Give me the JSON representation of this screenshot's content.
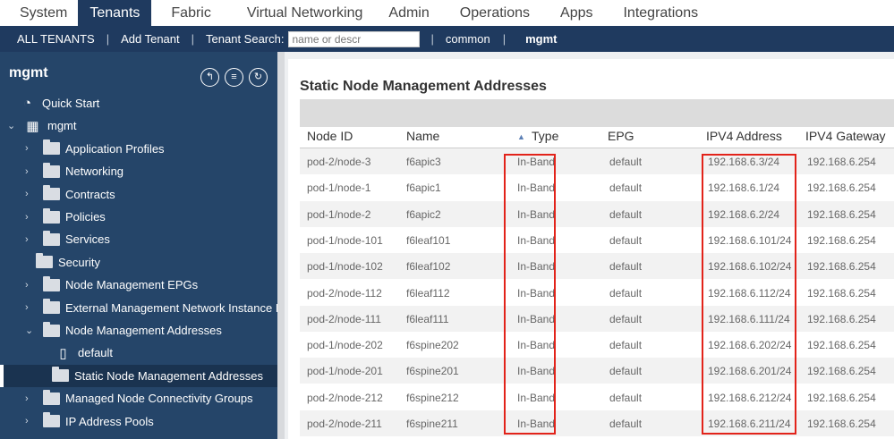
{
  "topnav": {
    "tabs": [
      "System",
      "Tenants",
      "Fabric",
      "Virtual Networking",
      "Admin",
      "Operations",
      "Apps",
      "Integrations"
    ],
    "active": "Tenants"
  },
  "tenant_bar": {
    "all_tenants": "ALL TENANTS",
    "add_tenant": "Add Tenant",
    "search_label": "Tenant Search:",
    "search_placeholder": "name or descr",
    "common": "common",
    "mgmt": "mgmt"
  },
  "sidebar": {
    "title": "mgmt",
    "items": [
      {
        "label": "Quick Start",
        "icon": "quick-start-icon"
      },
      {
        "label": "mgmt",
        "icon": "tenant-icon"
      },
      {
        "label": "Application Profiles",
        "icon": "folder-icon"
      },
      {
        "label": "Networking",
        "icon": "folder-icon"
      },
      {
        "label": "Contracts",
        "icon": "folder-icon"
      },
      {
        "label": "Policies",
        "icon": "folder-icon"
      },
      {
        "label": "Services",
        "icon": "folder-icon"
      },
      {
        "label": "Security",
        "icon": "folder-icon"
      },
      {
        "label": "Node Management EPGs",
        "icon": "folder-icon"
      },
      {
        "label": "External Management Network Instance Pr...",
        "icon": "folder-icon"
      },
      {
        "label": "Node Management Addresses",
        "icon": "folder-icon"
      },
      {
        "label": "default",
        "icon": "document-icon"
      },
      {
        "label": "Static Node Management Addresses",
        "icon": "folder-icon"
      },
      {
        "label": "Managed Node Connectivity Groups",
        "icon": "folder-icon"
      },
      {
        "label": "IP Address Pools",
        "icon": "folder-icon"
      }
    ]
  },
  "main": {
    "title": "Static Node Management Addresses",
    "columns": [
      "Node ID",
      "Name",
      "Type",
      "EPG",
      "IPV4 Address",
      "IPV4 Gateway"
    ],
    "rows": [
      [
        "pod-2/node-3",
        "f6apic3",
        "In-Band",
        "default",
        "192.168.6.3/24",
        "192.168.6.254"
      ],
      [
        "pod-1/node-1",
        "f6apic1",
        "In-Band",
        "default",
        "192.168.6.1/24",
        "192.168.6.254"
      ],
      [
        "pod-1/node-2",
        "f6apic2",
        "In-Band",
        "default",
        "192.168.6.2/24",
        "192.168.6.254"
      ],
      [
        "pod-1/node-101",
        "f6leaf101",
        "In-Band",
        "default",
        "192.168.6.101/24",
        "192.168.6.254"
      ],
      [
        "pod-1/node-102",
        "f6leaf102",
        "In-Band",
        "default",
        "192.168.6.102/24",
        "192.168.6.254"
      ],
      [
        "pod-2/node-112",
        "f6leaf112",
        "In-Band",
        "default",
        "192.168.6.112/24",
        "192.168.6.254"
      ],
      [
        "pod-2/node-111",
        "f6leaf111",
        "In-Band",
        "default",
        "192.168.6.111/24",
        "192.168.6.254"
      ],
      [
        "pod-1/node-202",
        "f6spine202",
        "In-Band",
        "default",
        "192.168.6.202/24",
        "192.168.6.254"
      ],
      [
        "pod-1/node-201",
        "f6spine201",
        "In-Band",
        "default",
        "192.168.6.201/24",
        "192.168.6.254"
      ],
      [
        "pod-2/node-212",
        "f6spine212",
        "In-Band",
        "default",
        "192.168.6.212/24",
        "192.168.6.254"
      ],
      [
        "pod-2/node-211",
        "f6spine211",
        "In-Band",
        "default",
        "192.168.6.211/24",
        "192.168.6.254"
      ]
    ]
  }
}
